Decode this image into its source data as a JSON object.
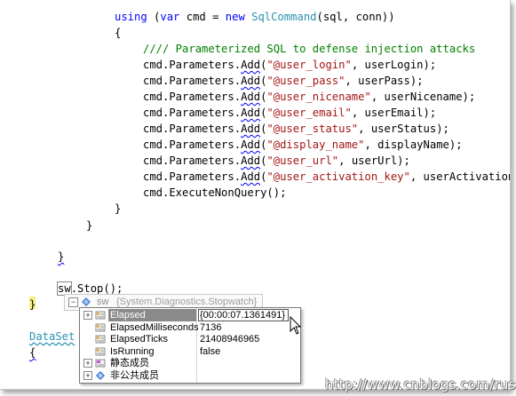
{
  "code": {
    "using_line": {
      "kw_using": "using",
      "open": " (",
      "kw_var": "var",
      "cmd": " cmd = ",
      "kw_new": "new",
      "type": "SqlCommand",
      "args": "(sql, conn))"
    },
    "open_brace": "{",
    "comment": "//// Parameterized SQL to defense injection attacks",
    "params": [
      {
        "prefix": "cmd.Parameters.",
        "method": "Add",
        "str": "\"@user_login\"",
        "rest": ", userLogin);"
      },
      {
        "prefix": "cmd.Parameters.",
        "method": "Add",
        "str": "\"@user_pass\"",
        "rest": ", userPass);"
      },
      {
        "prefix": "cmd.Parameters.",
        "method": "Add",
        "str": "\"@user_nicename\"",
        "rest": ", userNicename);"
      },
      {
        "prefix": "cmd.Parameters.",
        "method": "Add",
        "str": "\"@user_email\"",
        "rest": ", userEmail);"
      },
      {
        "prefix": "cmd.Parameters.",
        "method": "Add",
        "str": "\"@user_status\"",
        "rest": ", userStatus);"
      },
      {
        "prefix": "cmd.Parameters.",
        "method": "Add",
        "str": "\"@display_name\"",
        "rest": ", displayName);"
      },
      {
        "prefix": "cmd.Parameters.",
        "method": "Add",
        "str": "\"@user_url\"",
        "rest": ", userUrl);"
      },
      {
        "prefix": "cmd.Parameters.",
        "method": "Add",
        "str": "\"@user_activation_key\"",
        "rest": ", userActivationK"
      }
    ],
    "execute": "cmd.ExecuteNonQuery();",
    "close_brace": "}",
    "sw_obj": "sw",
    "sw_rest": ".Stop();",
    "dataset_type": "DataSet",
    "brace": "{"
  },
  "datatip": {
    "toggle": "−",
    "var_name": "sw",
    "var_value": "{System.Diagnostics.Stopwatch}",
    "rows": [
      {
        "expand": "+",
        "name": "Elapsed",
        "value": "{00:00:07.1361491}"
      },
      {
        "expand": "",
        "name": "ElapsedMilliseconds",
        "value": "7136"
      },
      {
        "expand": "",
        "name": "ElapsedTicks",
        "value": "21408946965"
      },
      {
        "expand": "",
        "name": "IsRunning",
        "value": "false"
      },
      {
        "expand": "+",
        "name": "静态成员",
        "value": ""
      },
      {
        "expand": "+",
        "name": "非公共成员",
        "value": ""
      }
    ]
  },
  "watermark": "http://www.cnblogs.com/rush",
  "colors": {
    "keyword": "#0000ff",
    "type": "#2b91af",
    "string": "#a31515",
    "comment": "#008000"
  }
}
